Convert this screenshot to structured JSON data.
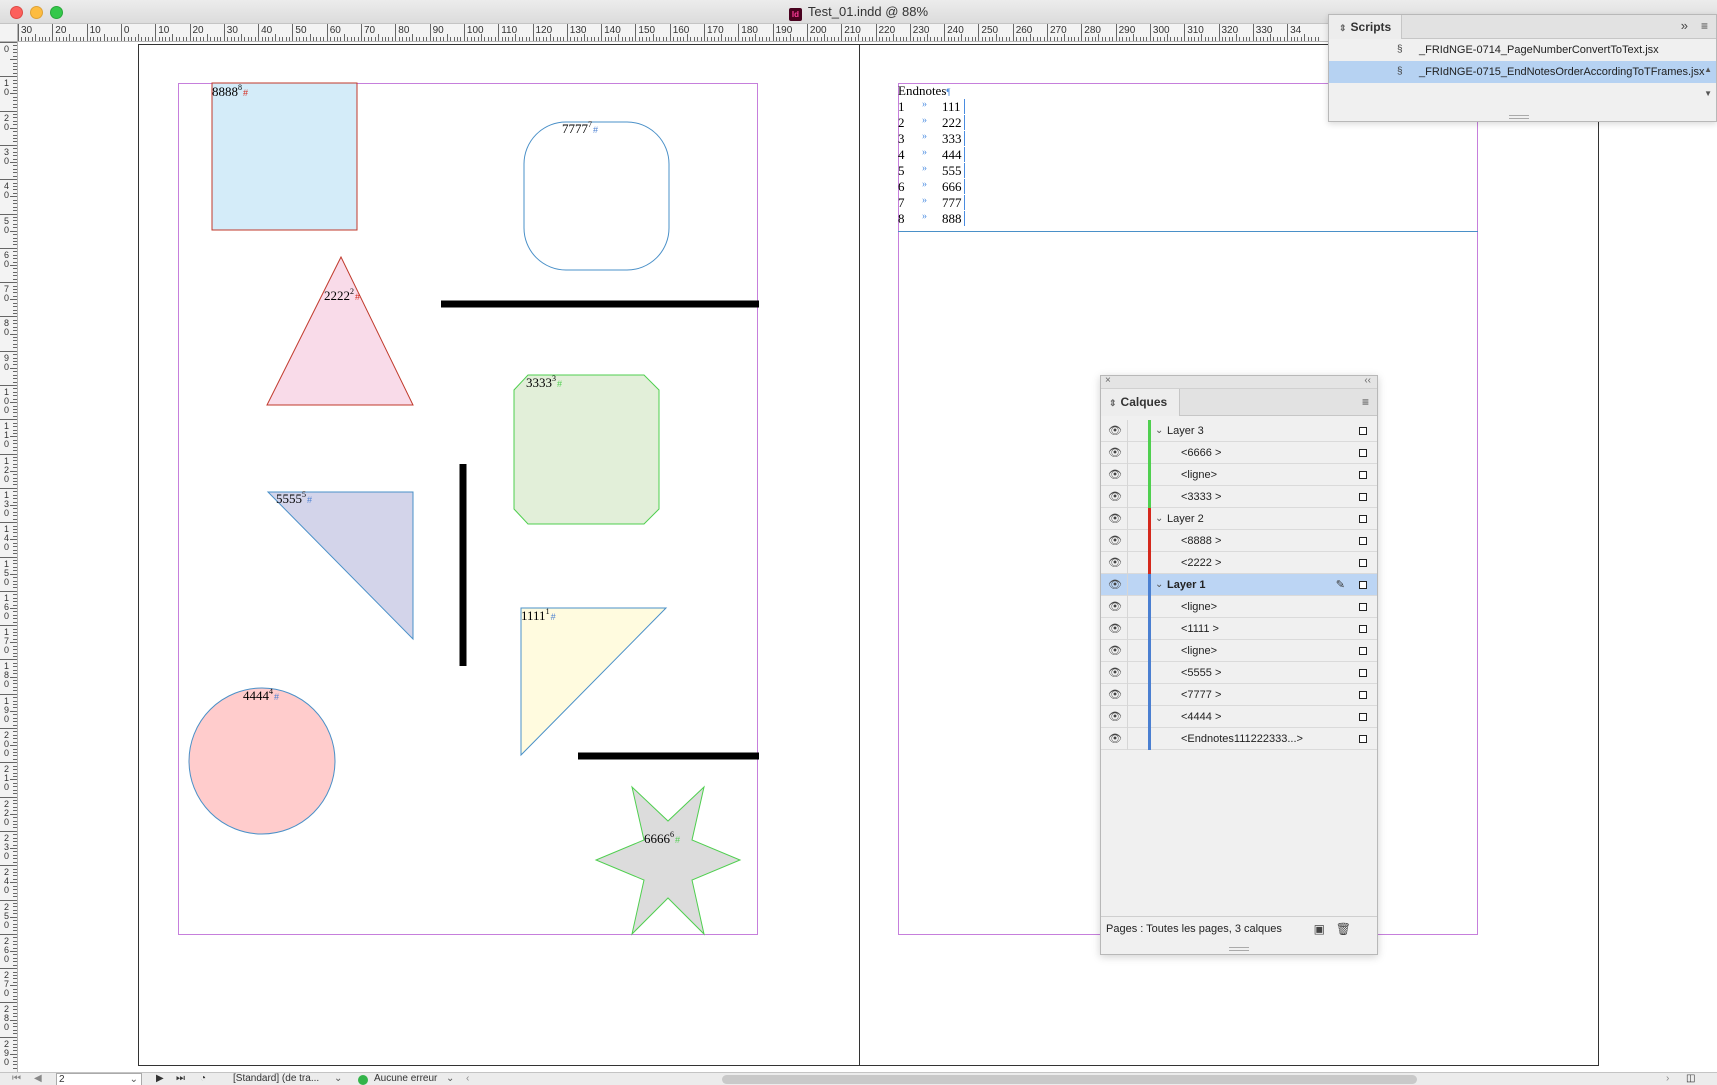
{
  "window": {
    "title": "Test_01.indd @ 88%",
    "app_icon_label": "Id"
  },
  "rulers": {
    "horizontal_labels": [
      "30",
      "20",
      "10",
      "0",
      "10",
      "20",
      "30",
      "40",
      "50",
      "60",
      "70",
      "80",
      "90",
      "100",
      "110",
      "120",
      "130",
      "140",
      "150",
      "160",
      "170",
      "180",
      "190",
      "200",
      "210",
      "220",
      "230",
      "240",
      "250",
      "260",
      "270",
      "280",
      "290",
      "300",
      "310",
      "320",
      "330",
      "34"
    ],
    "vertical_labels": [
      "0",
      "10",
      "20",
      "30",
      "40",
      "50",
      "60",
      "70",
      "80",
      "90",
      "100",
      "110",
      "120",
      "130",
      "140",
      "150",
      "160",
      "170",
      "180",
      "190",
      "200",
      "210",
      "220",
      "230",
      "240",
      "250",
      "260",
      "270",
      "280",
      "290"
    ]
  },
  "page_left": {
    "shapes": [
      {
        "name": "rectangle-8888",
        "label": "8888",
        "sup": "8",
        "fill": "#d4ecf9",
        "stroke": "#c0392b"
      },
      {
        "name": "rounded-rect-7777",
        "label": "7777",
        "sup": "7",
        "fill": "#ffffff",
        "stroke": "#4a90c8"
      },
      {
        "name": "triangle-2222",
        "label": "2222",
        "sup": "2",
        "fill": "#f9dbe9",
        "stroke": "#c0392b"
      },
      {
        "name": "octagon-3333",
        "label": "3333",
        "sup": "3",
        "fill": "#e2efd9",
        "stroke": "#4fcf4f"
      },
      {
        "name": "triangle-5555",
        "label": "5555",
        "sup": "5",
        "fill": "#d3d4ea",
        "stroke": "#4a90c8"
      },
      {
        "name": "triangle-1111",
        "label": "1111",
        "sup": "1",
        "fill": "#fffbdf",
        "stroke": "#4a90c8"
      },
      {
        "name": "circle-4444",
        "label": "4444",
        "sup": "4",
        "fill": "#ffcccc",
        "stroke": "#4a90c8"
      },
      {
        "name": "star-6666",
        "label": "6666",
        "sup": "6",
        "fill": "#dcdcdc",
        "stroke": "#4fcf4f"
      }
    ],
    "anchor_symbol": "#"
  },
  "page_right": {
    "endnotes_title": "Endnotes",
    "endnotes": [
      {
        "num": "1",
        "tab": "»",
        "value": "111"
      },
      {
        "num": "2",
        "tab": "»",
        "value": "222"
      },
      {
        "num": "3",
        "tab": "»",
        "value": "333"
      },
      {
        "num": "4",
        "tab": "»",
        "value": "444"
      },
      {
        "num": "5",
        "tab": "»",
        "value": "555"
      },
      {
        "num": "6",
        "tab": "»",
        "value": "666"
      },
      {
        "num": "7",
        "tab": "»",
        "value": "777"
      },
      {
        "num": "8",
        "tab": "»",
        "value": "888"
      }
    ]
  },
  "scripts_panel": {
    "title": "Scripts",
    "expand_glyph": "»",
    "items": [
      {
        "label": "_FRIdNGE-0714_PageNumberConvertToText.jsx",
        "selected": false
      },
      {
        "label": "_FRIdNGE-0715_EndNotesOrderAccordingToTFrames.jsx",
        "selected": true
      }
    ]
  },
  "layers_panel": {
    "title": "Calques",
    "rows": [
      {
        "label": "Layer 3",
        "type": "layer",
        "color": "#4fcf4f",
        "selected": false
      },
      {
        "label": "<6666 >",
        "type": "item",
        "color": "#4fcf4f",
        "selected": false
      },
      {
        "label": "<ligne>",
        "type": "item",
        "color": "#4fcf4f",
        "selected": false
      },
      {
        "label": "<3333 >",
        "type": "item",
        "color": "#4fcf4f",
        "selected": false
      },
      {
        "label": "Layer 2",
        "type": "layer",
        "color": "#d4281c",
        "selected": false
      },
      {
        "label": "<8888 >",
        "type": "item",
        "color": "#d4281c",
        "selected": false
      },
      {
        "label": "<2222 >",
        "type": "item",
        "color": "#d4281c",
        "selected": false
      },
      {
        "label": "Layer 1",
        "type": "layer",
        "color": "#4a7fd1",
        "selected": true
      },
      {
        "label": "<ligne>",
        "type": "item",
        "color": "#4a7fd1",
        "selected": false
      },
      {
        "label": "<1111 >",
        "type": "item",
        "color": "#4a7fd1",
        "selected": false
      },
      {
        "label": "<ligne>",
        "type": "item",
        "color": "#4a7fd1",
        "selected": false
      },
      {
        "label": "<5555 >",
        "type": "item",
        "color": "#4a7fd1",
        "selected": false
      },
      {
        "label": "<7777 >",
        "type": "item",
        "color": "#4a7fd1",
        "selected": false
      },
      {
        "label": "<4444 >",
        "type": "item",
        "color": "#4a7fd1",
        "selected": false
      },
      {
        "label": "<Endnotes111222333...>",
        "type": "item",
        "color": "#4a7fd1",
        "selected": false
      }
    ],
    "footer": "Pages : Toutes les pages, 3 calques"
  },
  "statusbar": {
    "page_number": "2",
    "preflight_profile": "[Standard] (de tra...",
    "preflight_status": "Aucune erreur",
    "status_color": "#34b44a"
  }
}
